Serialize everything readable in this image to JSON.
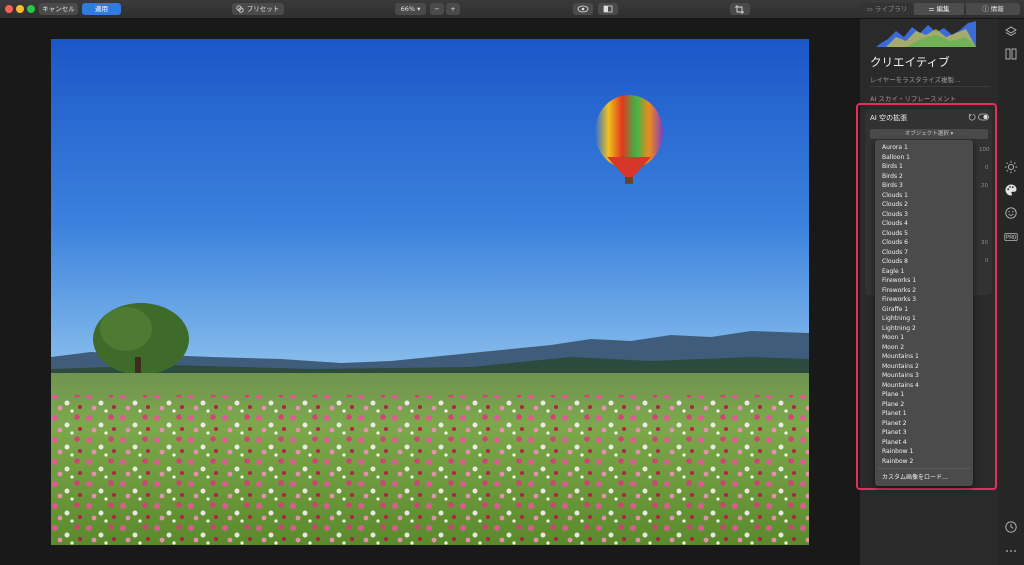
{
  "toolbar": {
    "cancel_label": "キャンセル",
    "apply_label": "適用",
    "preset_label": "プリセット",
    "zoom_value": "66%",
    "zoom_minus": "−",
    "zoom_plus": "+",
    "tabs": [
      {
        "label": "ライブラリ"
      },
      {
        "label": "編集"
      },
      {
        "label": "情報"
      }
    ]
  },
  "panel": {
    "title": "クリエイティブ",
    "subtitle": "レイヤーをラスタライズ複製…",
    "section_label": "AI スカイ・リプレースメント",
    "ai_section_title": "AI 空の拡張",
    "object_select_label": "オブジェクト選択 ▾",
    "ghost_values": [
      "100",
      "0",
      "20",
      "30",
      "0"
    ]
  },
  "dropdown": {
    "items": [
      "Aurora 1",
      "Balloon 1",
      "Birds 1",
      "Birds 2",
      "Birds 3",
      "Clouds 1",
      "Clouds 2",
      "Clouds 3",
      "Clouds 4",
      "Clouds 5",
      "Clouds 6",
      "Clouds 7",
      "Clouds 8",
      "Eagle 1",
      "Fireworks 1",
      "Fireworks 2",
      "Fireworks 3",
      "Giraffe 1",
      "Lightning 1",
      "Lightning 2",
      "Moon 1",
      "Moon 2",
      "Mountains 1",
      "Mountains 2",
      "Mountains 3",
      "Mountains 4",
      "Plane 1",
      "Plane 2",
      "Planet 1",
      "Planet 2",
      "Planet 3",
      "Planet 4",
      "Rainbow 1",
      "Rainbow 2"
    ],
    "load_custom_label": "カスタム画像をロード…"
  },
  "colors": {
    "accent_blue": "#2f7be0",
    "highlight_red": "#e62e5c",
    "panel_bg": "#2a2a2a"
  },
  "icons": [
    "layers-icon",
    "compare-icon",
    "sun-icon",
    "palette-icon",
    "smiley-icon",
    "pro-icon",
    "history-icon",
    "more-icon",
    "eye-icon",
    "split-view-icon",
    "crop-icon",
    "preset-icon"
  ]
}
